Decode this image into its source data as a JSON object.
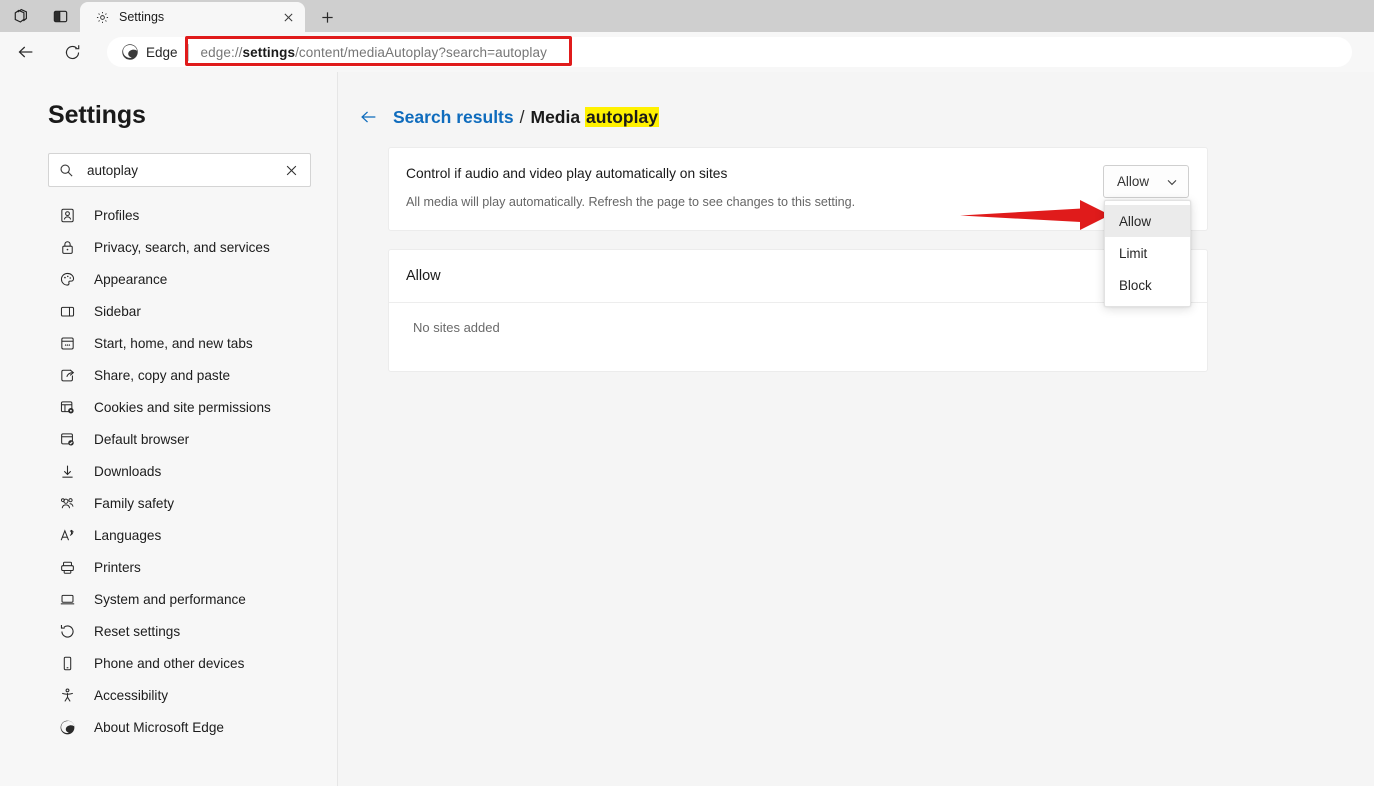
{
  "window": {
    "titlebar_buttons": [
      {
        "name": "tab-copilot-icon",
        "label": ""
      },
      {
        "name": "tab-split-icon",
        "label": ""
      }
    ],
    "tab": {
      "title": "Settings",
      "favicon": "gear-icon",
      "close_label": "×"
    },
    "new_tab_label": "+"
  },
  "toolbar": {
    "back_label": "",
    "reload_label": "",
    "edge_chip_label": "Edge",
    "url_prefix": "edge://",
    "url_bold": "settings",
    "url_suffix": "/content/mediaAutoplay?search=autoplay",
    "url_full": "edge://settings/content/mediaAutoplay?search=autoplay"
  },
  "annotations": {
    "url_highlight_color": "#e01b1b",
    "arrow_color": "#e01b1b",
    "highlight_color": "#fff100"
  },
  "sidebar": {
    "title": "Settings",
    "search": {
      "value": "autoplay",
      "placeholder": "Search settings",
      "icon": "search-icon",
      "clear_icon": "close-icon"
    },
    "items": [
      {
        "label": "Profiles",
        "icon": "profile-card-icon"
      },
      {
        "label": "Privacy, search, and services",
        "icon": "lock-icon"
      },
      {
        "label": "Appearance",
        "icon": "palette-icon"
      },
      {
        "label": "Sidebar",
        "icon": "sidebar-panel-icon"
      },
      {
        "label": "Start, home, and new tabs",
        "icon": "new-tab-page-icon"
      },
      {
        "label": "Share, copy and paste",
        "icon": "share-icon"
      },
      {
        "label": "Cookies and site permissions",
        "icon": "cookies-gear-icon"
      },
      {
        "label": "Default browser",
        "icon": "browser-check-icon"
      },
      {
        "label": "Downloads",
        "icon": "download-arrow-icon"
      },
      {
        "label": "Family safety",
        "icon": "people-icon"
      },
      {
        "label": "Languages",
        "icon": "translate-icon"
      },
      {
        "label": "Printers",
        "icon": "printer-icon"
      },
      {
        "label": "System and performance",
        "icon": "laptop-icon"
      },
      {
        "label": "Reset settings",
        "icon": "reset-circular-arrow-icon"
      },
      {
        "label": "Phone and other devices",
        "icon": "phone-icon"
      },
      {
        "label": "Accessibility",
        "icon": "accessibility-person-icon"
      },
      {
        "label": "About Microsoft Edge",
        "icon": "edge-logo-icon"
      }
    ]
  },
  "main": {
    "breadcrumb": {
      "back_icon": "back-arrow-icon",
      "parent": "Search results",
      "separator": "/",
      "current_prefix": "Media ",
      "current_highlight": "autoplay"
    },
    "setting": {
      "title": "Control if audio and video play automatically on sites",
      "description": "All media will play automatically. Refresh the page to see changes to this setting.",
      "select_value": "Allow",
      "select_chevron": "chevron-down-icon",
      "options": [
        {
          "label": "Allow",
          "selected": true
        },
        {
          "label": "Limit",
          "selected": false
        },
        {
          "label": "Block",
          "selected": false
        }
      ]
    },
    "allow_section": {
      "header": "Allow",
      "empty_text": "No sites added"
    }
  }
}
